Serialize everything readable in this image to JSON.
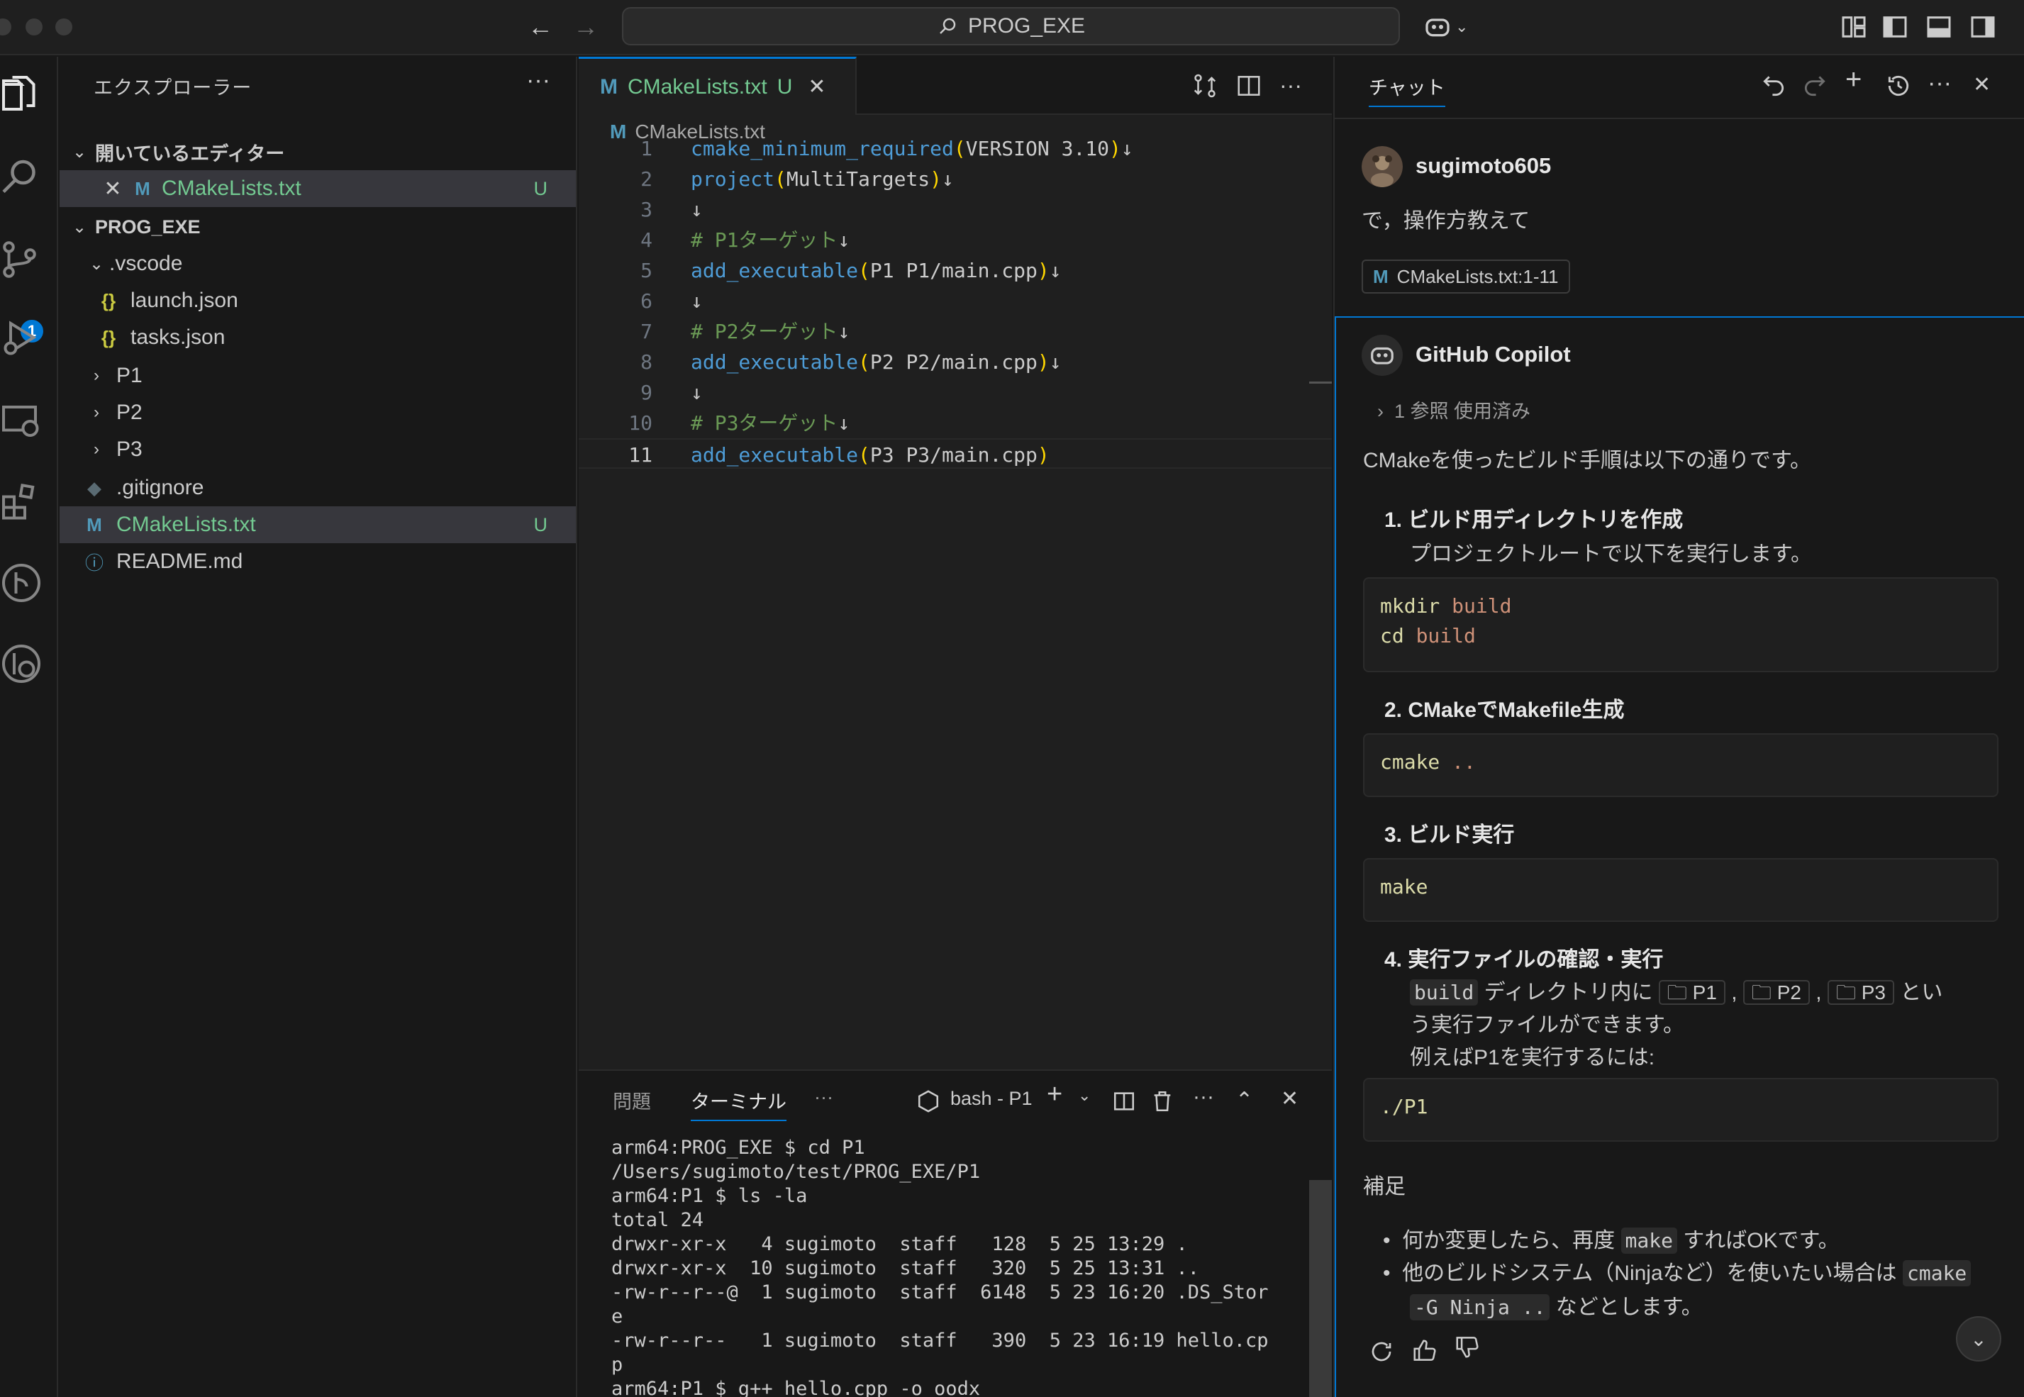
{
  "window": {
    "command_center": "PROG_EXE"
  },
  "sidebar": {
    "title": "エクスプローラー",
    "more": "···",
    "open_editors_header": "開いているエディター",
    "open_editors": [
      {
        "close": "✕",
        "icon": "M",
        "name": "CMakeLists.txt",
        "status": "U"
      }
    ],
    "project_header": "PROG_EXE",
    "tree": [
      {
        "name": ".vscode",
        "chev": "⌄",
        "icon": "",
        "indent": 1
      },
      {
        "name": "launch.json",
        "chev": "",
        "icon": "{}",
        "indent": 2
      },
      {
        "name": "tasks.json",
        "chev": "",
        "icon": "{}",
        "indent": 2
      },
      {
        "name": "P1",
        "chev": "›",
        "icon": "",
        "indent": 1
      },
      {
        "name": "P2",
        "chev": "›",
        "icon": "",
        "indent": 1
      },
      {
        "name": "P3",
        "chev": "›",
        "icon": "",
        "indent": 1
      },
      {
        "name": ".gitignore",
        "chev": "",
        "icon": "◆",
        "indent": 1
      },
      {
        "name": "CMakeLists.txt",
        "chev": "",
        "icon": "M",
        "indent": 1,
        "status": "U"
      },
      {
        "name": "README.md",
        "chev": "",
        "icon": "ⓘ",
        "indent": 1
      }
    ],
    "scm_badge": "1"
  },
  "editor": {
    "tab": {
      "icon": "M",
      "name": "CMakeLists.txt",
      "status": "U",
      "close": "✕"
    },
    "breadcrumb": {
      "icon": "M",
      "file": "CMakeLists.txt"
    },
    "lines": [
      {
        "n": "1",
        "text": "cmake_minimum_required(VERSION 3.10)↓"
      },
      {
        "n": "2",
        "text": "project(MultiTargets)↓"
      },
      {
        "n": "3",
        "text": "↓"
      },
      {
        "n": "4",
        "text": "# P1ターゲット↓"
      },
      {
        "n": "5",
        "text": "add_executable(P1 P1/main.cpp)↓"
      },
      {
        "n": "6",
        "text": "↓"
      },
      {
        "n": "7",
        "text": "# P2ターゲット↓"
      },
      {
        "n": "8",
        "text": "add_executable(P2 P2/main.cpp)↓"
      },
      {
        "n": "9",
        "text": "↓"
      },
      {
        "n": "10",
        "text": "# P3ターゲット↓"
      },
      {
        "n": "11",
        "text": "add_executable(P3 P3/main.cpp)"
      }
    ],
    "current_line": "11"
  },
  "panel": {
    "tabs": [
      "問題",
      "ターミナル",
      "···"
    ],
    "active_tab": "ターミナル",
    "terminal_name": "bash - P1",
    "terminal_output": "arm64:PROG_EXE $ cd P1\n/Users/sugimoto/test/PROG_EXE/P1\narm64:P1 $ ls -la\ntotal 24\ndrwxr-xr-x   4 sugimoto  staff   128  5 25 13:29 .\ndrwxr-xr-x  10 sugimoto  staff   320  5 25 13:31 ..\n-rw-r--r--@  1 sugimoto  staff  6148  5 23 16:20 .DS_Stor\ne\n-rw-r--r--   1 sugimoto  staff   390  5 23 16:19 hello.cp\np\narm64:P1 $ g++ hello.cpp -o oodx"
  },
  "chat": {
    "title": "チャット",
    "user": {
      "name": "sugimoto605",
      "message": "で，操作方教えて",
      "ref": "CMakeLists.txt:1-11",
      "ref_icon": "M"
    },
    "assistant": {
      "name": "GitHub Copilot",
      "refs_used": "1 参照 使用済み",
      "intro": "CMakeを使ったビルド手順は以下の通りです。",
      "steps": [
        {
          "num": "1.",
          "title": "ビルド用ディレクトリを作成",
          "desc": "プロジェクトルートで以下を実行します。"
        },
        {
          "num": "2.",
          "title": "CMakeでMakefile生成"
        },
        {
          "num": "3.",
          "title": "ビルド実行"
        },
        {
          "num": "4.",
          "title": "実行ファイルの確認・実行"
        }
      ],
      "code1_l1_cmd": "mkdir",
      "code1_l1_arg": " build",
      "code1_l2_cmd": "cd",
      "code1_l2_arg": " build",
      "code2_cmd": "cmake",
      "code2_arg": " ..",
      "code3_cmd": "make",
      "step4_inline_build": "build",
      "step4_text_a": " ディレクトリ内に ",
      "step4_chip1": "🗀 P1",
      "step4_chip2": "🗀 P2",
      "step4_chip3": "🗀 P3",
      "step4_text_b": " とい",
      "step4_line2": "う実行ファイルができます。",
      "step4_line3": "例えばP1を実行するには:",
      "code4": "./P1",
      "supplement": "補足",
      "bullet1_a": "何か変更したら、再度 ",
      "bullet1_code": "make",
      "bullet1_b": " すればOKです。",
      "bullet2_a": "他のビルドシステム（Ninjaなど）を使いたい場合は ",
      "bullet2_code1": "cmake",
      "bullet2_code2": "-G Ninja ..",
      "bullet2_b": " などとします。"
    }
  },
  "colors": {
    "accent": "#0078d4",
    "untracked": "#73c991",
    "function": "#4e9cd6",
    "comment": "#6a9955"
  }
}
